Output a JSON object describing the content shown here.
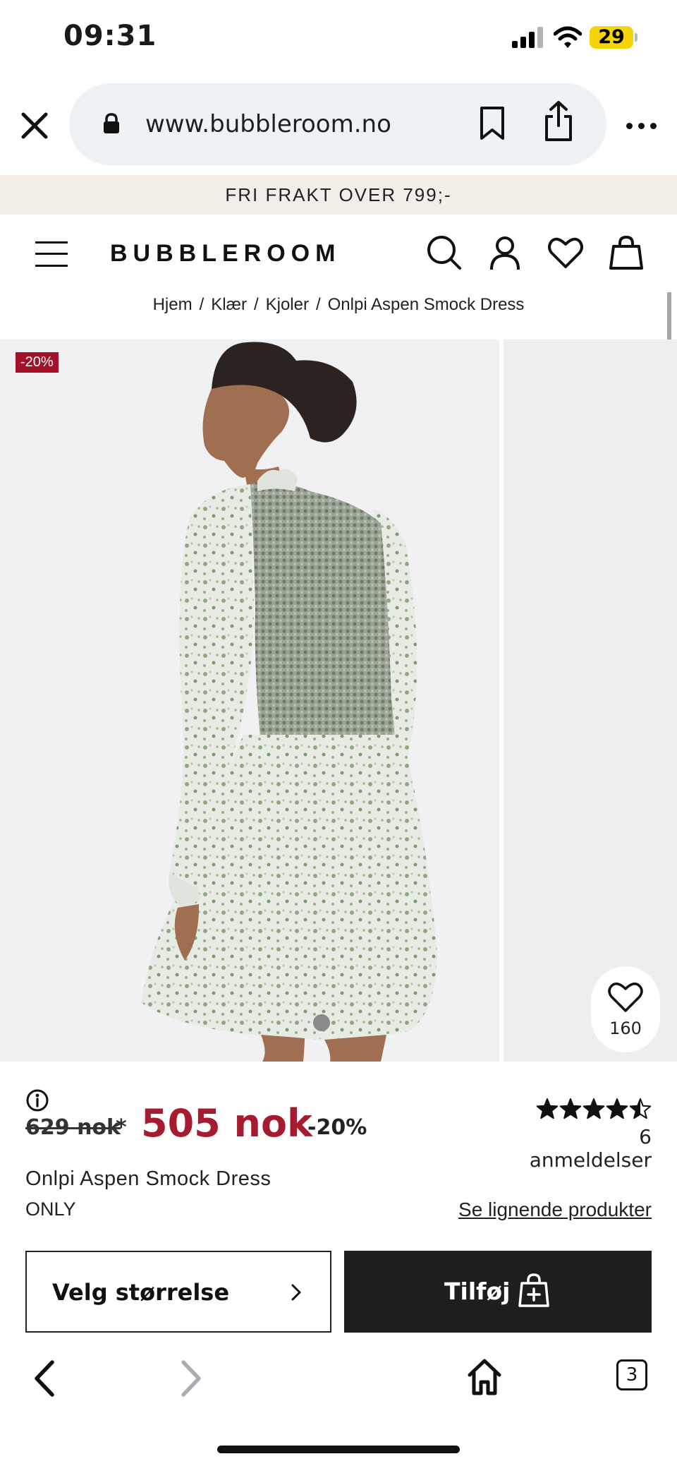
{
  "status_bar": {
    "time": "09:31",
    "battery": "29",
    "icons": [
      "signal-icon",
      "wifi-icon",
      "battery-icon"
    ]
  },
  "browser": {
    "url": "www.bubbleroom.no",
    "icons": [
      "close-icon",
      "lock-icon",
      "bookmark-icon",
      "share-icon",
      "more-icon"
    ]
  },
  "promo": {
    "text": "FRI FRAKT OVER 799;-"
  },
  "header": {
    "logo": "BUBBLEROOM",
    "icons": [
      "menu-icon",
      "search-icon",
      "account-icon",
      "wishlist-heart-icon",
      "shopping-bag-icon"
    ]
  },
  "breadcrumb": {
    "items": [
      "Hjem",
      "Klær",
      "Kjoler",
      "Onlpi Aspen Smock Dress"
    ],
    "separator": "/"
  },
  "gallery": {
    "discount_badge": "-20%",
    "favorites_count": "160"
  },
  "product": {
    "old_price": "629 nok",
    "asterisk": "*",
    "price": "505 nok",
    "discount": "-20%",
    "rating": 4.5,
    "rating_max": 5,
    "reviews": "6 anmeldelser",
    "name": "Onlpi Aspen Smock Dress",
    "brand": "ONLY",
    "similar_link": "Se lignende produkter"
  },
  "actions": {
    "select_size": "Velg størrelse",
    "add": "Tilføj"
  },
  "bottom_bar": {
    "tabs_count": "3",
    "icons": [
      "back-icon",
      "forward-icon",
      "home-icon",
      "tabs-icon"
    ]
  },
  "colors": {
    "sale_red": "#a51c30",
    "badge_red": "#a31228",
    "promo_bg": "#f3ede8",
    "button_dark": "#1e1e1e",
    "url_pill": "#eef2f4",
    "battery_yellow": "#f5d40a"
  }
}
